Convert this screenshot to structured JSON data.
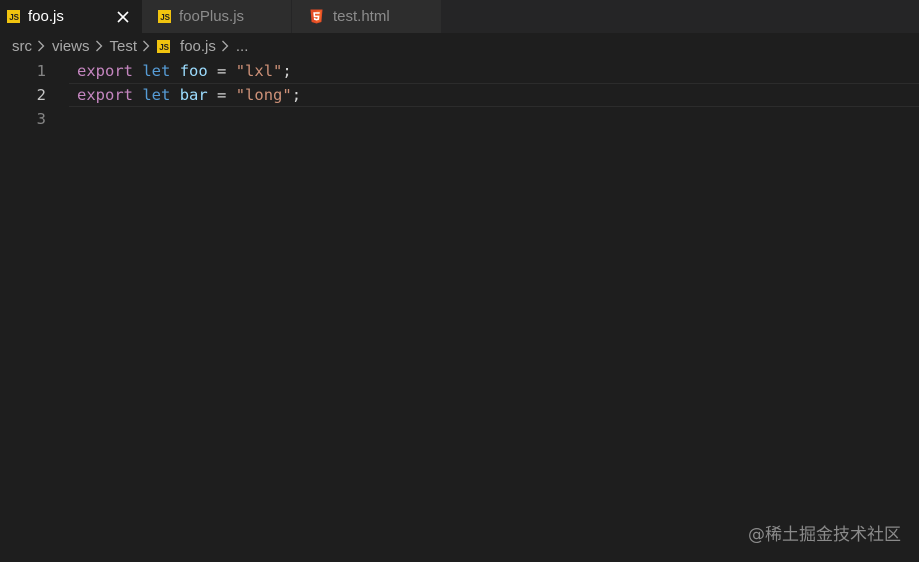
{
  "tabs": [
    {
      "label": "foo.js",
      "icon": "js-file-icon",
      "active": true,
      "close": "✕"
    },
    {
      "label": "fooPlus.js",
      "icon": "js-file-icon",
      "active": false
    },
    {
      "label": "test.html",
      "icon": "html5-file-icon",
      "active": false
    }
  ],
  "js_badge": "JS",
  "breadcrumb": {
    "items": [
      "src",
      "views",
      "Test"
    ],
    "file": "foo.js",
    "more": "..."
  },
  "editor": {
    "lines": [
      {
        "number": "1",
        "export": "export",
        "let": "let",
        "name": "foo",
        "eq": "=",
        "value": "\"lxl\"",
        "semi": ";"
      },
      {
        "number": "2",
        "export": "export",
        "let": "let",
        "name": "bar",
        "eq": "=",
        "value": "\"long\"",
        "semi": ";"
      },
      {
        "number": "3"
      }
    ],
    "current_line": 2
  },
  "watermark": "@稀土掘金技术社区",
  "colors": {
    "background": "#1e1e1e",
    "tabbar": "#252526",
    "js_icon": "#f1c40f",
    "html_icon": "#e44d26",
    "keyword_export": "#c586c0",
    "keyword_let": "#569cd6",
    "identifier": "#9cdcfe",
    "string": "#ce9178"
  }
}
